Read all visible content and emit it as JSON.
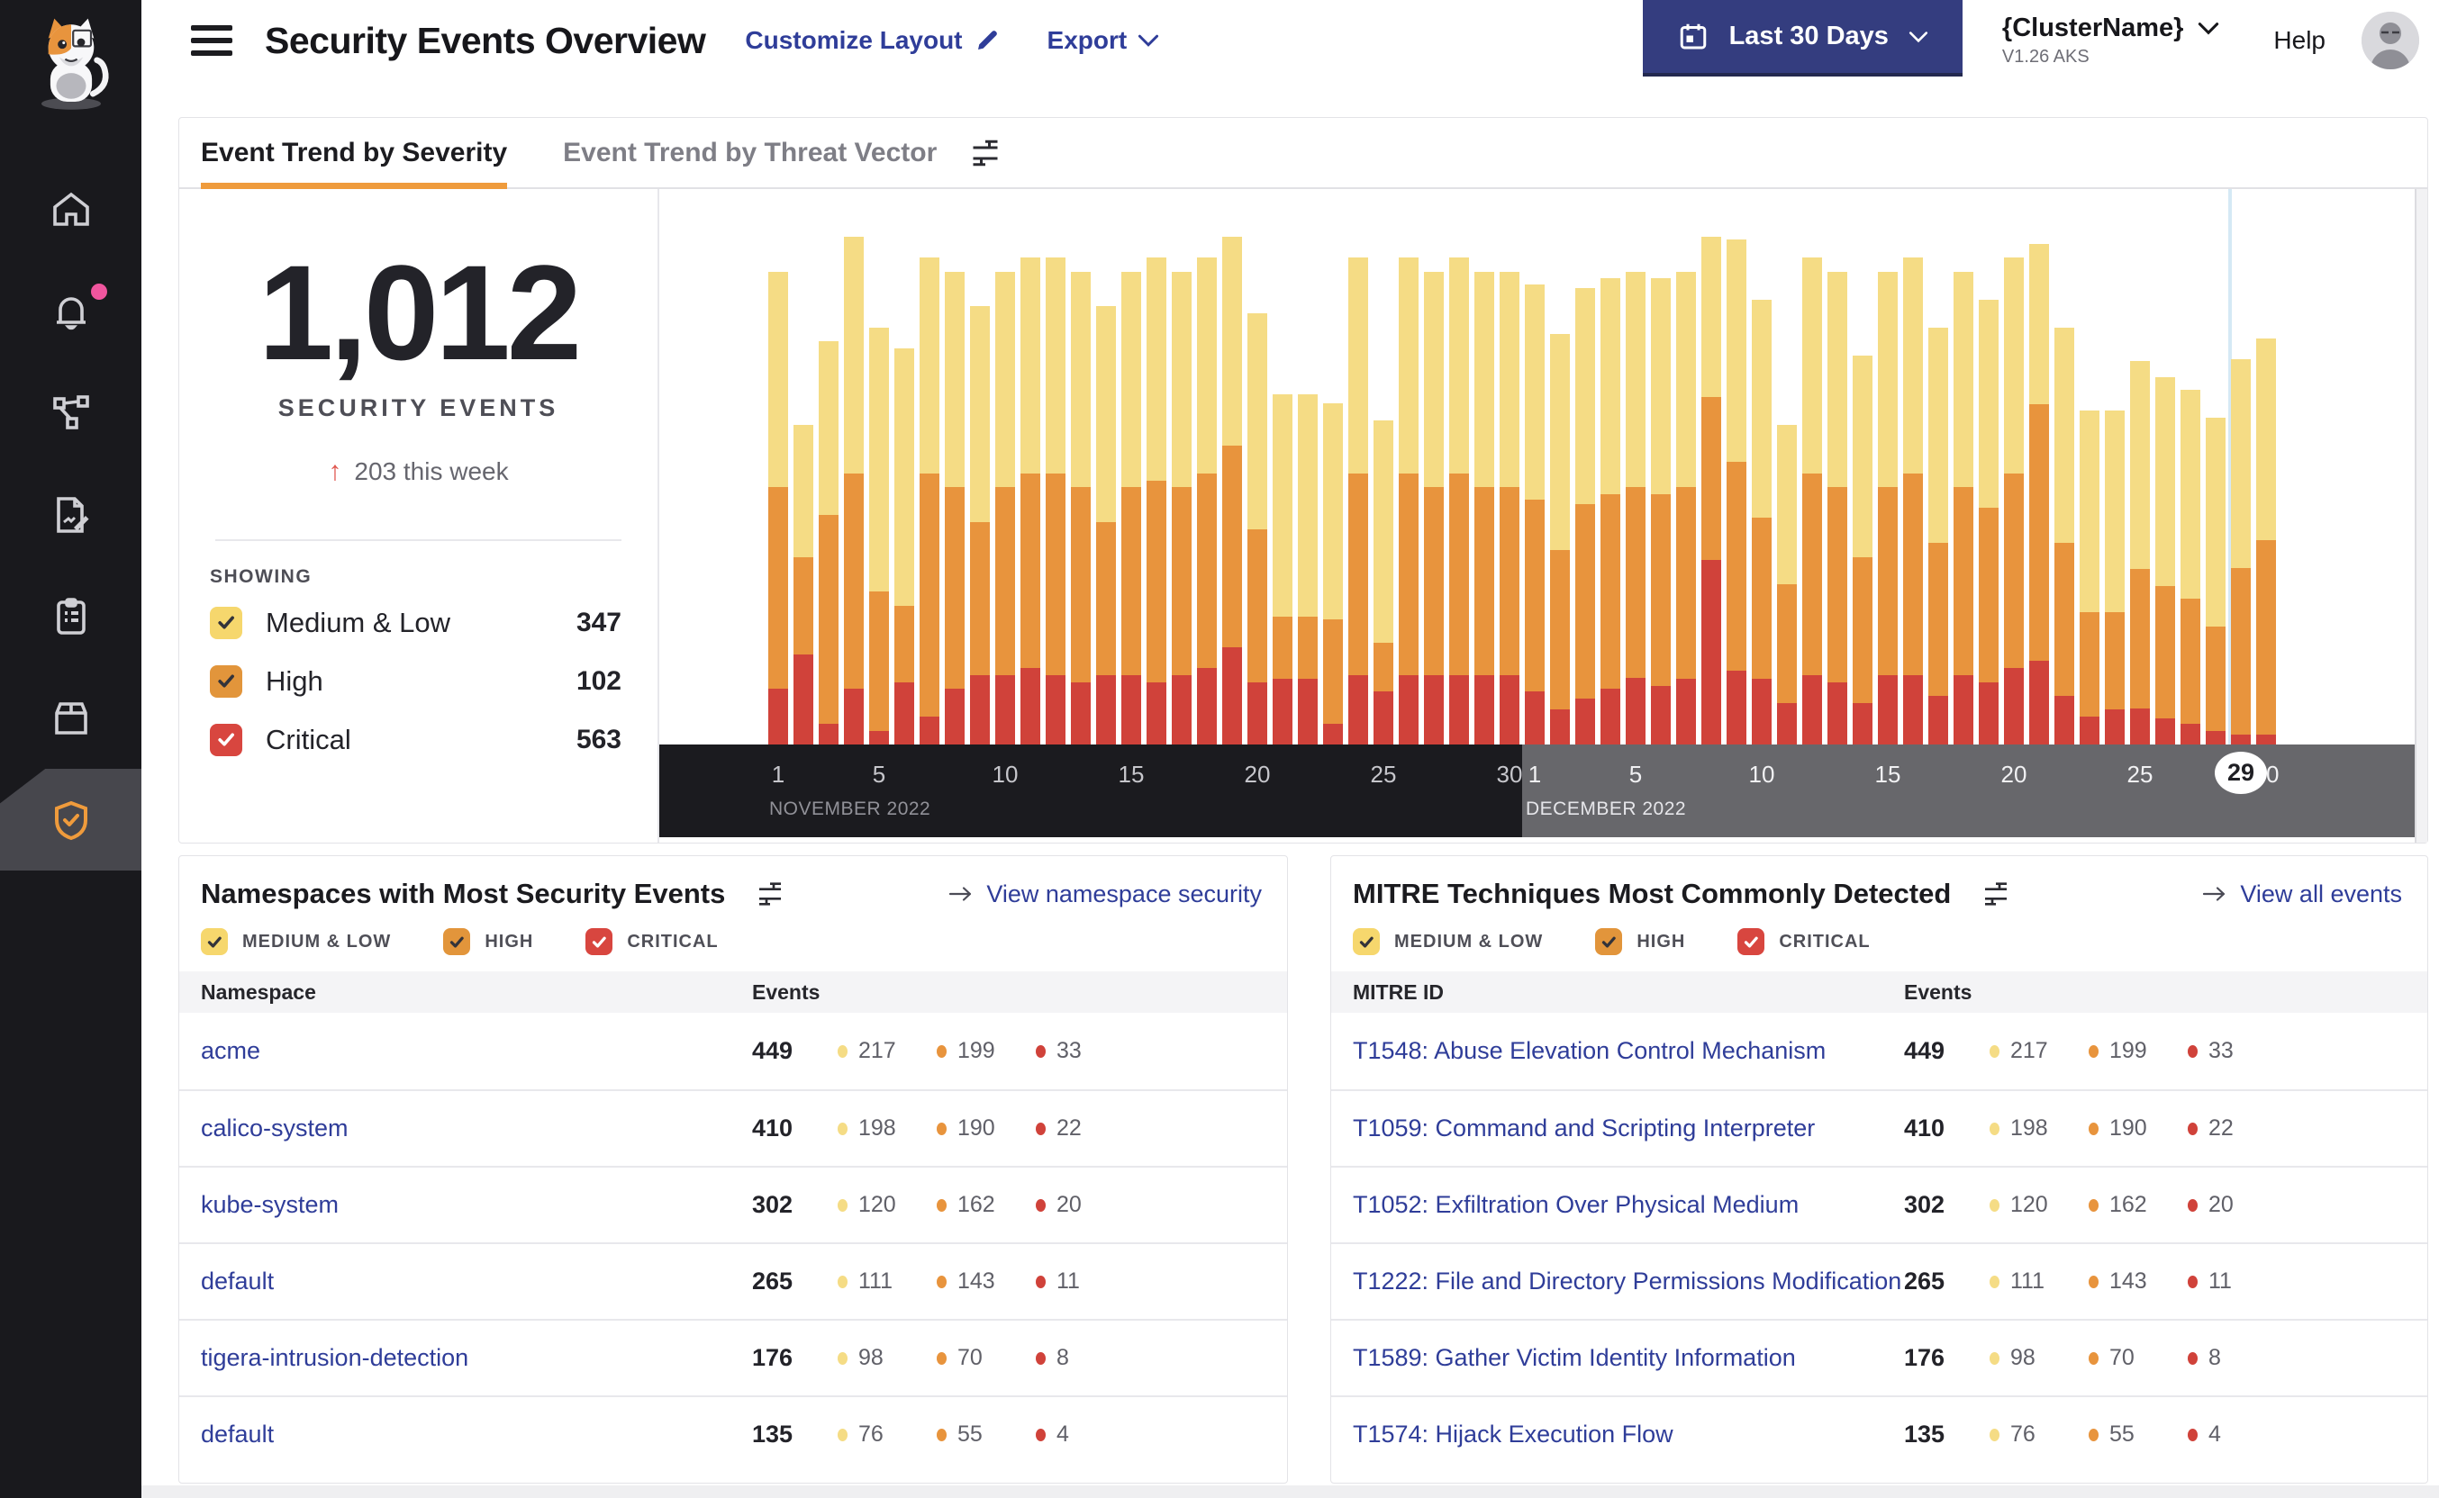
{
  "colors": {
    "accent-orange": "#EF9B3C",
    "severity-medium-low": "#F5DC85",
    "severity-high": "#E8943D",
    "severity-critical": "#D0423A",
    "checkbox-medium-low": "#F6D76D",
    "checkbox-high": "#E2953B",
    "checkbox-critical": "#D8463F",
    "link-navy": "#2F3D99",
    "date-button-bg": "#343D7F",
    "axis-november-bg": "#1B1B1F",
    "axis-december-bg": "#67676B",
    "notification-pink": "#F0559E",
    "highlight-line-blue": "#D5E9F5"
  },
  "sidebar": {
    "items": [
      {
        "icon": "home-icon"
      },
      {
        "icon": "bell-icon",
        "badge": true
      },
      {
        "icon": "service-graph-icon"
      },
      {
        "icon": "policy-edit-icon"
      },
      {
        "icon": "compliance-clipboard-icon"
      },
      {
        "icon": "workloads-box-icon"
      },
      {
        "icon": "shield-check-icon",
        "active": true
      }
    ]
  },
  "header": {
    "title": "Security Events Overview",
    "customize_layout_label": "Customize Layout",
    "export_label": "Export",
    "date_range_label": "Last 30 Days",
    "cluster_name": "{ClusterName}",
    "cluster_version": "V1.26 AKS",
    "help_label": "Help"
  },
  "trend_card": {
    "tabs": [
      {
        "label": "Event Trend by Severity",
        "active": true
      },
      {
        "label": "Event Trend by Threat Vector",
        "active": false
      }
    ],
    "summary": {
      "total": "1,012",
      "caption": "SECURITY EVENTS",
      "delta_arrow": "↑",
      "delta_text": "203 this week"
    },
    "showing_label": "SHOWING",
    "legend": [
      {
        "label": "Medium & Low",
        "count": "347",
        "severity": "ml"
      },
      {
        "label": "High",
        "count": "102",
        "severity": "hi"
      },
      {
        "label": "Critical",
        "count": "563",
        "severity": "cr"
      }
    ]
  },
  "chart_data": {
    "type": "bar",
    "subtype": "stacked-daily",
    "title": "Event Trend by Severity",
    "note": "No y-axis labels shown; per-day values estimated from bar heights (relative units, plot max = 40)",
    "ylim": [
      0,
      40
    ],
    "series_bottom_to_top": [
      "critical",
      "high",
      "medium_low"
    ],
    "columns": [
      "date",
      "medium_low",
      "high",
      "critical"
    ],
    "values": [
      [
        "Nov 1",
        15.5,
        14.5,
        4
      ],
      [
        "Nov 2",
        9.5,
        7,
        6.5
      ],
      [
        "Nov 3",
        12.5,
        15,
        1.5
      ],
      [
        "Nov 4",
        17,
        15.5,
        4
      ],
      [
        "Nov 5",
        19,
        10,
        1
      ],
      [
        "Nov 6",
        18.5,
        5.5,
        4.5
      ],
      [
        "Nov 7",
        15.5,
        17.5,
        2
      ],
      [
        "Nov 8",
        15.5,
        14.5,
        4
      ],
      [
        "Nov 9",
        15.5,
        11,
        5
      ],
      [
        "Nov 10",
        15.5,
        13.5,
        5
      ],
      [
        "Nov 11",
        15.5,
        14,
        5.5
      ],
      [
        "Nov 12",
        15.5,
        14.5,
        5
      ],
      [
        "Nov 13",
        15.5,
        14,
        4.5
      ],
      [
        "Nov 14",
        15.5,
        11,
        5
      ],
      [
        "Nov 15",
        15.5,
        13.5,
        5
      ],
      [
        "Nov 16",
        16,
        14.5,
        4.5
      ],
      [
        "Nov 17",
        15.5,
        13.5,
        5
      ],
      [
        "Nov 18",
        15.5,
        14,
        5.5
      ],
      [
        "Nov 19",
        15,
        14.5,
        7
      ],
      [
        "Nov 20",
        15.5,
        11,
        4.5
      ],
      [
        "Nov 21",
        16,
        4.5,
        4.7
      ],
      [
        "Nov 22",
        16,
        4.5,
        4.7
      ],
      [
        "Nov 23",
        15.5,
        7.5,
        1.5
      ],
      [
        "Nov 24",
        15.5,
        14.5,
        5
      ],
      [
        "Nov 25",
        16,
        3.5,
        3.8
      ],
      [
        "Nov 26",
        15.5,
        14.5,
        5
      ],
      [
        "Nov 27",
        15.5,
        13.5,
        5
      ],
      [
        "Nov 28",
        15.5,
        14.5,
        5
      ],
      [
        "Nov 29",
        15.5,
        13.5,
        5
      ],
      [
        "Nov 30",
        15.5,
        13.5,
        5
      ],
      [
        "Dec 1",
        15.5,
        13.8,
        3.8
      ],
      [
        "Dec 2",
        15.5,
        11.5,
        2.5
      ],
      [
        "Dec 3",
        15.5,
        14,
        3.3
      ],
      [
        "Dec 4",
        15.5,
        14,
        4
      ],
      [
        "Dec 5",
        15.5,
        13.7,
        4.8
      ],
      [
        "Dec 6",
        15.5,
        13.8,
        4.2
      ],
      [
        "Dec 7",
        15.5,
        13.8,
        4.7
      ],
      [
        "Dec 8",
        11.5,
        11.7,
        13.3
      ],
      [
        "Dec 9",
        16,
        15,
        5.3
      ],
      [
        "Dec 10",
        15.7,
        11.6,
        4.7
      ],
      [
        "Dec 11",
        11.5,
        8.5,
        3
      ],
      [
        "Dec 12",
        15.5,
        14.5,
        5
      ],
      [
        "Dec 13",
        15.5,
        14,
        4.5
      ],
      [
        "Dec 14",
        14.5,
        10.5,
        3
      ],
      [
        "Dec 15",
        15.5,
        13.5,
        5
      ],
      [
        "Dec 16",
        15.5,
        14.5,
        5
      ],
      [
        "Dec 17",
        15.5,
        11,
        3.5
      ],
      [
        "Dec 18",
        15.5,
        13.5,
        5
      ],
      [
        "Dec 19",
        15,
        12.5,
        4.5
      ],
      [
        "Dec 20",
        15.5,
        14,
        5.5
      ],
      [
        "Dec 21",
        11.5,
        18.5,
        6
      ],
      [
        "Dec 22",
        15.5,
        11,
        3.5
      ],
      [
        "Dec 23",
        14.5,
        7.5,
        2
      ],
      [
        "Dec 24",
        14.5,
        7,
        2.5
      ],
      [
        "Dec 25",
        15,
        10,
        2.6
      ],
      [
        "Dec 26",
        15,
        9.5,
        1.9
      ],
      [
        "Dec 27",
        15,
        9,
        1.5
      ],
      [
        "Dec 28",
        15,
        7.5,
        1
      ],
      [
        "Dec 29",
        15,
        12,
        0.7
      ],
      [
        "Dec 30",
        14.5,
        14,
        0.7
      ]
    ],
    "months": [
      {
        "label": "NOVEMBER 2022",
        "ticks": [
          1,
          5,
          10,
          15,
          20,
          25,
          30
        ]
      },
      {
        "label": "DECEMBER 2022",
        "ticks": [
          1,
          5,
          10,
          15,
          20,
          25,
          30
        ]
      }
    ],
    "highlighted_day": {
      "month": "December",
      "day": 29,
      "label": "29"
    },
    "legend_position": "left-panel",
    "grid": false
  },
  "namespaces_card": {
    "title": "Namespaces with Most Security Events",
    "link_label": "View namespace security",
    "filters": [
      "MEDIUM & LOW",
      "HIGH",
      "CRITICAL"
    ],
    "columns": {
      "name": "Namespace",
      "events": "Events"
    },
    "rows": [
      {
        "name": "acme",
        "total": "449",
        "medium_low": "217",
        "high": "199",
        "critical": "33"
      },
      {
        "name": "calico-system",
        "total": "410",
        "medium_low": "198",
        "high": "190",
        "critical": "22"
      },
      {
        "name": "kube-system",
        "total": "302",
        "medium_low": "120",
        "high": "162",
        "critical": "20"
      },
      {
        "name": "default",
        "total": "265",
        "medium_low": "111",
        "high": "143",
        "critical": "11"
      },
      {
        "name": "tigera-intrusion-detection",
        "total": "176",
        "medium_low": "98",
        "high": "70",
        "critical": "8"
      },
      {
        "name": "default",
        "total": "135",
        "medium_low": "76",
        "high": "55",
        "critical": "4"
      }
    ]
  },
  "mitre_card": {
    "title": "MITRE Techniques Most Commonly Detected",
    "link_label": "View all events",
    "filters": [
      "MEDIUM & LOW",
      "HIGH",
      "CRITICAL"
    ],
    "columns": {
      "name": "MITRE ID",
      "events": "Events"
    },
    "rows": [
      {
        "name": "T1548: Abuse Elevation Control Mechanism",
        "total": "449",
        "medium_low": "217",
        "high": "199",
        "critical": "33"
      },
      {
        "name": "T1059: Command and Scripting Interpreter",
        "total": "410",
        "medium_low": "198",
        "high": "190",
        "critical": "22"
      },
      {
        "name": "T1052: Exfiltration Over Physical Medium",
        "total": "302",
        "medium_low": "120",
        "high": "162",
        "critical": "20"
      },
      {
        "name": "T1222: File and Directory Permissions Modification",
        "total": "265",
        "medium_low": "111",
        "high": "143",
        "critical": "11"
      },
      {
        "name": "T1589: Gather Victim Identity Information",
        "total": "176",
        "medium_low": "98",
        "high": "70",
        "critical": "8"
      },
      {
        "name": "T1574: Hijack Execution Flow",
        "total": "135",
        "medium_low": "76",
        "high": "55",
        "critical": "4"
      }
    ]
  }
}
